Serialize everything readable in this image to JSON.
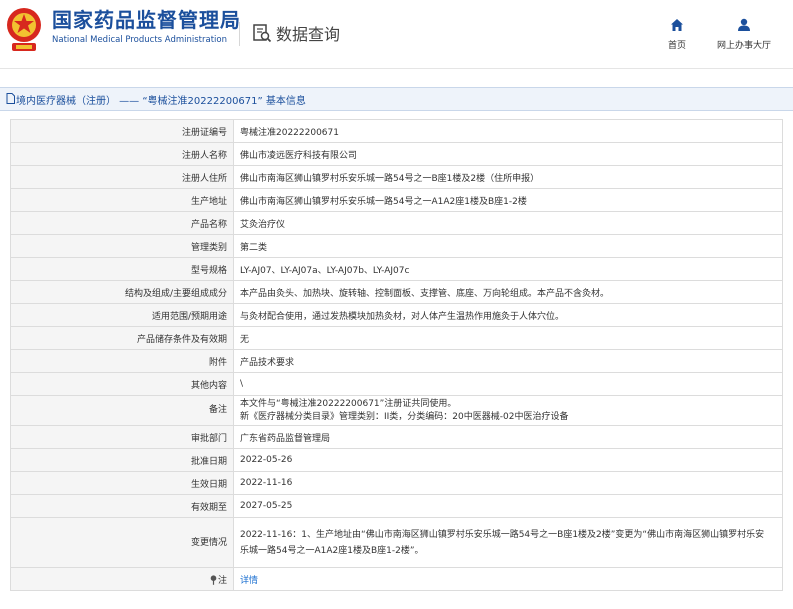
{
  "header": {
    "title_cn": "国家药品监督管理局",
    "title_en": "National Medical Products Administration",
    "data_query": "数据查询",
    "nav": [
      {
        "label": "首页",
        "icon": "home-icon"
      },
      {
        "label": "网上办事大厅",
        "icon": "user-icon"
      }
    ]
  },
  "breadcrumb": "境内医疗器械（注册） —— “粤械注准20222200671” 基本信息",
  "rows": [
    {
      "key": "注册证编号",
      "value": "粤械注准20222200671"
    },
    {
      "key": "注册人名称",
      "value": "佛山市凌远医疗科技有限公司"
    },
    {
      "key": "注册人住所",
      "value": "佛山市南海区狮山镇罗村乐安乐城一路54号之一B座1楼及2楼（住所申报）"
    },
    {
      "key": "生产地址",
      "value": "佛山市南海区狮山镇罗村乐安乐城一路54号之一A1A2座1楼及B座1-2楼"
    },
    {
      "key": "产品名称",
      "value": "艾灸治疗仪"
    },
    {
      "key": "管理类别",
      "value": "第二类"
    },
    {
      "key": "型号规格",
      "value": "LY-AJ07、LY-AJ07a、LY-AJ07b、LY-AJ07c"
    },
    {
      "key": "结构及组成/主要组成成分",
      "value": "本产品由灸头、加热块、旋转轴、控制面板、支撑管、底座、万向轮组成。本产品不含灸材。"
    },
    {
      "key": "适用范围/预期用途",
      "value": "与灸材配合使用，通过发热模块加热灸材，对人体产生温热作用施灸于人体穴位。"
    },
    {
      "key": "产品储存条件及有效期",
      "value": "无"
    },
    {
      "key": "附件",
      "value": "产品技术要求"
    },
    {
      "key": "其他内容",
      "value": "\\"
    }
  ],
  "remark": {
    "key": "备注",
    "line1": "本文件与“粤械注准20222200671”注册证共同使用。",
    "line2": "新《医疗器械分类目录》管理类别：II类，分类编码：20中医器械-02中医治疗设备"
  },
  "rows2": [
    {
      "key": "审批部门",
      "value": "广东省药品监督管理局"
    },
    {
      "key": "批准日期",
      "value": "2022-05-26"
    },
    {
      "key": "生效日期",
      "value": "2022-11-16"
    },
    {
      "key": "有效期至",
      "value": "2027-05-25"
    }
  ],
  "change": {
    "key": "变更情况",
    "line1": "2022-11-16：1、生产地址由“佛山市南海区狮山镇罗村乐安乐城一路54号之一B座1楼及2楼”变更为“佛山市南海区狮山镇罗村乐安",
    "line2": "乐城一路54号之一A1A2座1楼及B座1-2楼”。"
  },
  "note": {
    "key": "注",
    "link": "详情"
  },
  "colors": {
    "brand_blue": "#1b4f9c",
    "link_blue": "#1b6fd0"
  }
}
